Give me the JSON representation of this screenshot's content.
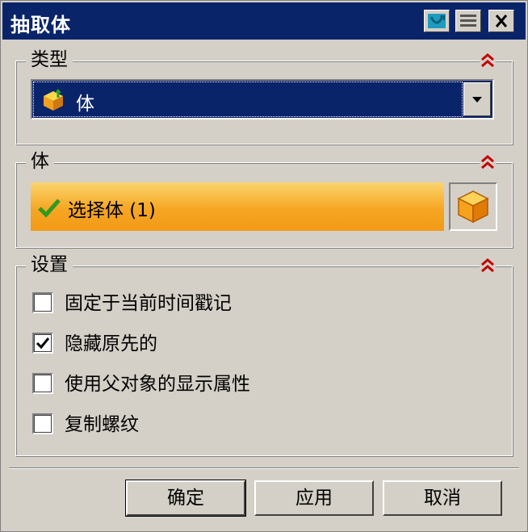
{
  "window": {
    "title": "抽取体"
  },
  "type_group": {
    "title": "类型",
    "combo": {
      "selected": "体",
      "icon": "body-extract-icon"
    }
  },
  "body_group": {
    "title": "体",
    "select_label": "选择体 (1)",
    "status_icon": "green-check-icon",
    "select_button_icon": "orange-cube-icon"
  },
  "settings_group": {
    "title": "设置",
    "options": [
      {
        "label": "固定于当前时间戳记",
        "checked": false
      },
      {
        "label": "隐藏原先的",
        "checked": true
      },
      {
        "label": "使用父对象的显示属性",
        "checked": false
      },
      {
        "label": "复制螺纹",
        "checked": false
      }
    ]
  },
  "footer": {
    "ok": "确定",
    "apply": "应用",
    "cancel": "取消"
  },
  "colors": {
    "title_bar": "#0a246a",
    "select_bar": "#f6a623",
    "collapse_arrow": "#c00000",
    "background": "#d4d0c8"
  }
}
